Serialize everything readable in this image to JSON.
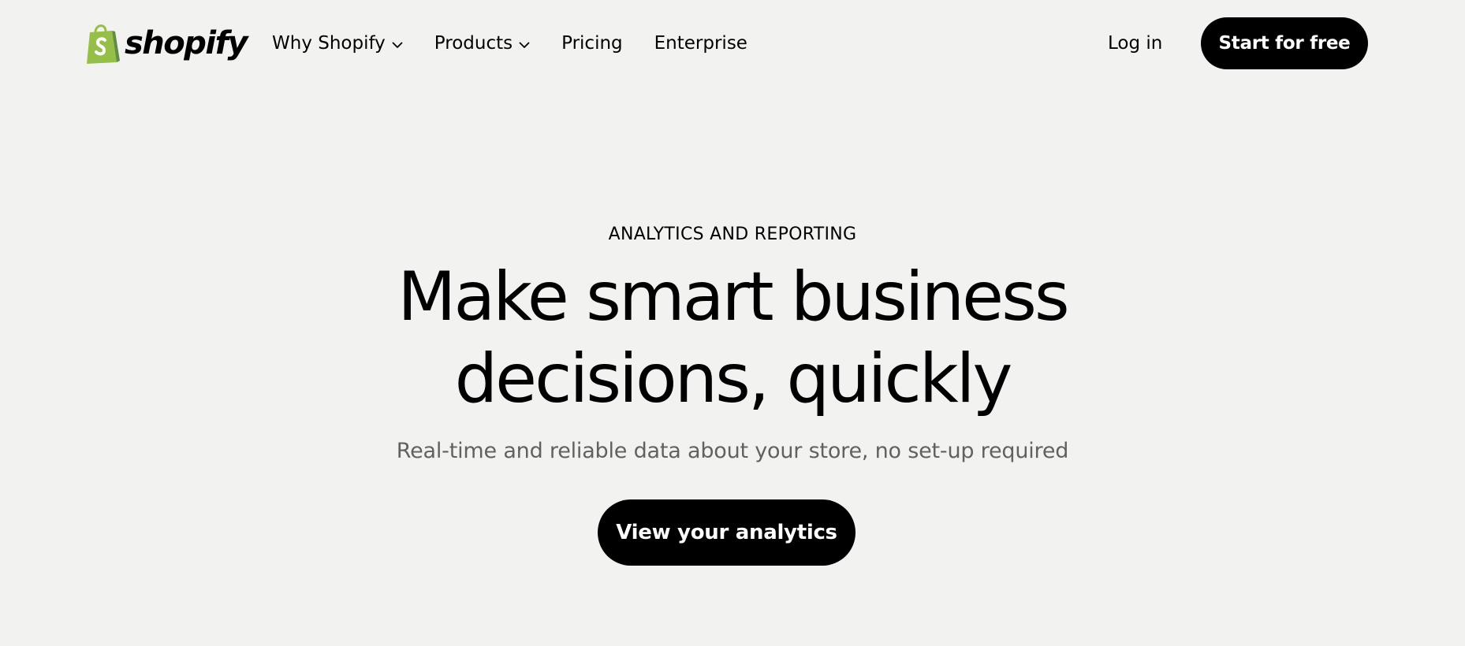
{
  "brand": {
    "name": "shopify",
    "logo_icon": "shopify-bag-icon",
    "logo_color": "#95bf47",
    "logo_dark_color": "#5e8e3e"
  },
  "nav": {
    "items": [
      {
        "label": "Why Shopify",
        "has_dropdown": true
      },
      {
        "label": "Products",
        "has_dropdown": true
      },
      {
        "label": "Pricing",
        "has_dropdown": false
      },
      {
        "label": "Enterprise",
        "has_dropdown": false
      }
    ],
    "login_label": "Log in",
    "cta_label": "Start for free"
  },
  "hero": {
    "eyebrow": "ANALYTICS AND REPORTING",
    "headline_line1": "Make smart business",
    "headline_line2": "decisions, quickly",
    "subline": "Real-time and reliable data about your store, no set-up required",
    "cta_label": "View your analytics"
  },
  "colors": {
    "background": "#f2f2f1",
    "text": "#000000",
    "muted_text": "#616161",
    "button_bg": "#000000",
    "button_text": "#ffffff"
  }
}
